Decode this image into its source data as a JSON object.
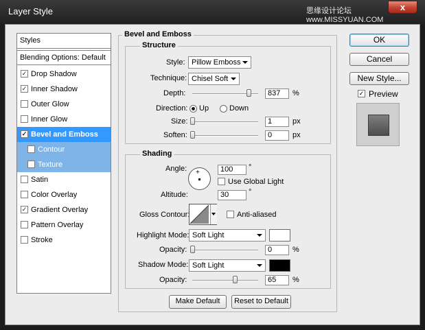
{
  "window": {
    "title": "Layer Style",
    "watermark": "思缘设计论坛 www.MISSYUAN.COM",
    "close_label": "x"
  },
  "styles_panel": {
    "header": "Styles",
    "blending_options": "Blending Options: Default",
    "items": [
      {
        "label": "Drop Shadow",
        "checked": true
      },
      {
        "label": "Inner Shadow",
        "checked": true
      },
      {
        "label": "Outer Glow",
        "checked": false
      },
      {
        "label": "Inner Glow",
        "checked": false
      },
      {
        "label": "Bevel and Emboss",
        "checked": true,
        "selected": true
      },
      {
        "label": "Contour",
        "checked": false,
        "sub": true
      },
      {
        "label": "Texture",
        "checked": false,
        "sub": true
      },
      {
        "label": "Satin",
        "checked": false
      },
      {
        "label": "Color Overlay",
        "checked": false
      },
      {
        "label": "Gradient Overlay",
        "checked": true
      },
      {
        "label": "Pattern Overlay",
        "checked": false
      },
      {
        "label": "Stroke",
        "checked": false
      }
    ]
  },
  "bevel": {
    "title": "Bevel and Emboss",
    "structure": {
      "title": "Structure",
      "style_label": "Style:",
      "style_value": "Pillow Emboss",
      "technique_label": "Technique:",
      "technique_value": "Chisel Soft",
      "depth_label": "Depth:",
      "depth_value": "837",
      "depth_unit": "%",
      "depth_level": 0.85,
      "direction_label": "Direction:",
      "direction_up": "Up",
      "direction_down": "Down",
      "direction_selected": "Up",
      "size_label": "Size:",
      "size_value": "1",
      "size_unit": "px",
      "size_level": 0.0,
      "soften_label": "Soften:",
      "soften_value": "0",
      "soften_unit": "px",
      "soften_level": 0.0
    },
    "shading": {
      "title": "Shading",
      "angle_label": "Angle:",
      "angle_value": "100",
      "angle_unit": "°",
      "use_global_light": "Use Global Light",
      "use_global_light_checked": false,
      "altitude_label": "Altitude:",
      "altitude_value": "30",
      "altitude_unit": "°",
      "gloss_contour_label": "Gloss Contour:",
      "anti_aliased": "Anti-aliased",
      "anti_aliased_checked": false,
      "highlight_mode_label": "Highlight Mode:",
      "highlight_mode_value": "Soft Light",
      "highlight_color": "#ffffff",
      "highlight_opacity_label": "Opacity:",
      "highlight_opacity_value": "0",
      "highlight_opacity_unit": "%",
      "highlight_opacity_level": 0.0,
      "shadow_mode_label": "Shadow Mode:",
      "shadow_mode_value": "Soft Light",
      "shadow_color": "#000000",
      "shadow_opacity_label": "Opacity:",
      "shadow_opacity_value": "65",
      "shadow_opacity_unit": "%",
      "shadow_opacity_level": 0.65
    },
    "make_default": "Make Default",
    "reset_default": "Reset to Default"
  },
  "buttons": {
    "ok": "OK",
    "cancel": "Cancel",
    "new_style": "New Style...",
    "preview": "Preview",
    "preview_checked": true
  },
  "colors": {
    "selected_row": "#3399ff",
    "sub_row": "#7fb4e8",
    "dialog_bg": "#ececec",
    "close": "#c24232"
  }
}
